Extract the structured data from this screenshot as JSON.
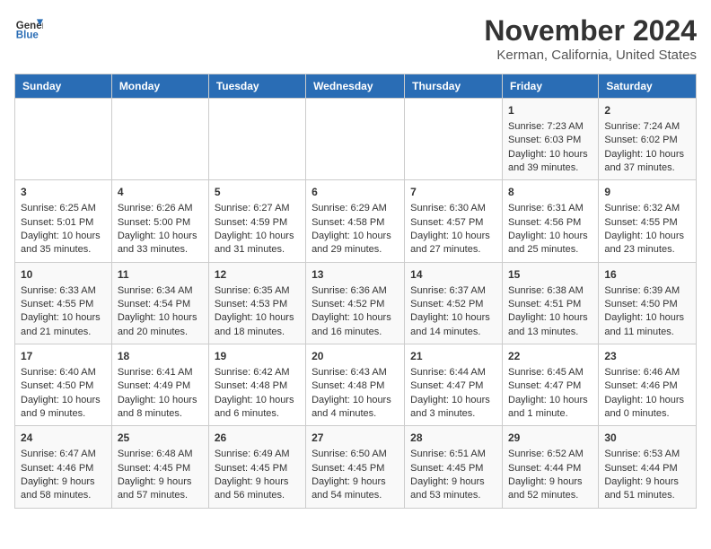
{
  "logo": {
    "line1": "General",
    "line2": "Blue"
  },
  "title": "November 2024",
  "subtitle": "Kerman, California, United States",
  "days_of_week": [
    "Sunday",
    "Monday",
    "Tuesday",
    "Wednesday",
    "Thursday",
    "Friday",
    "Saturday"
  ],
  "weeks": [
    [
      {
        "day": "",
        "content": ""
      },
      {
        "day": "",
        "content": ""
      },
      {
        "day": "",
        "content": ""
      },
      {
        "day": "",
        "content": ""
      },
      {
        "day": "",
        "content": ""
      },
      {
        "day": "1",
        "content": "Sunrise: 7:23 AM\nSunset: 6:03 PM\nDaylight: 10 hours and 39 minutes."
      },
      {
        "day": "2",
        "content": "Sunrise: 7:24 AM\nSunset: 6:02 PM\nDaylight: 10 hours and 37 minutes."
      }
    ],
    [
      {
        "day": "3",
        "content": "Sunrise: 6:25 AM\nSunset: 5:01 PM\nDaylight: 10 hours and 35 minutes."
      },
      {
        "day": "4",
        "content": "Sunrise: 6:26 AM\nSunset: 5:00 PM\nDaylight: 10 hours and 33 minutes."
      },
      {
        "day": "5",
        "content": "Sunrise: 6:27 AM\nSunset: 4:59 PM\nDaylight: 10 hours and 31 minutes."
      },
      {
        "day": "6",
        "content": "Sunrise: 6:29 AM\nSunset: 4:58 PM\nDaylight: 10 hours and 29 minutes."
      },
      {
        "day": "7",
        "content": "Sunrise: 6:30 AM\nSunset: 4:57 PM\nDaylight: 10 hours and 27 minutes."
      },
      {
        "day": "8",
        "content": "Sunrise: 6:31 AM\nSunset: 4:56 PM\nDaylight: 10 hours and 25 minutes."
      },
      {
        "day": "9",
        "content": "Sunrise: 6:32 AM\nSunset: 4:55 PM\nDaylight: 10 hours and 23 minutes."
      }
    ],
    [
      {
        "day": "10",
        "content": "Sunrise: 6:33 AM\nSunset: 4:55 PM\nDaylight: 10 hours and 21 minutes."
      },
      {
        "day": "11",
        "content": "Sunrise: 6:34 AM\nSunset: 4:54 PM\nDaylight: 10 hours and 20 minutes."
      },
      {
        "day": "12",
        "content": "Sunrise: 6:35 AM\nSunset: 4:53 PM\nDaylight: 10 hours and 18 minutes."
      },
      {
        "day": "13",
        "content": "Sunrise: 6:36 AM\nSunset: 4:52 PM\nDaylight: 10 hours and 16 minutes."
      },
      {
        "day": "14",
        "content": "Sunrise: 6:37 AM\nSunset: 4:52 PM\nDaylight: 10 hours and 14 minutes."
      },
      {
        "day": "15",
        "content": "Sunrise: 6:38 AM\nSunset: 4:51 PM\nDaylight: 10 hours and 13 minutes."
      },
      {
        "day": "16",
        "content": "Sunrise: 6:39 AM\nSunset: 4:50 PM\nDaylight: 10 hours and 11 minutes."
      }
    ],
    [
      {
        "day": "17",
        "content": "Sunrise: 6:40 AM\nSunset: 4:50 PM\nDaylight: 10 hours and 9 minutes."
      },
      {
        "day": "18",
        "content": "Sunrise: 6:41 AM\nSunset: 4:49 PM\nDaylight: 10 hours and 8 minutes."
      },
      {
        "day": "19",
        "content": "Sunrise: 6:42 AM\nSunset: 4:48 PM\nDaylight: 10 hours and 6 minutes."
      },
      {
        "day": "20",
        "content": "Sunrise: 6:43 AM\nSunset: 4:48 PM\nDaylight: 10 hours and 4 minutes."
      },
      {
        "day": "21",
        "content": "Sunrise: 6:44 AM\nSunset: 4:47 PM\nDaylight: 10 hours and 3 minutes."
      },
      {
        "day": "22",
        "content": "Sunrise: 6:45 AM\nSunset: 4:47 PM\nDaylight: 10 hours and 1 minute."
      },
      {
        "day": "23",
        "content": "Sunrise: 6:46 AM\nSunset: 4:46 PM\nDaylight: 10 hours and 0 minutes."
      }
    ],
    [
      {
        "day": "24",
        "content": "Sunrise: 6:47 AM\nSunset: 4:46 PM\nDaylight: 9 hours and 58 minutes."
      },
      {
        "day": "25",
        "content": "Sunrise: 6:48 AM\nSunset: 4:45 PM\nDaylight: 9 hours and 57 minutes."
      },
      {
        "day": "26",
        "content": "Sunrise: 6:49 AM\nSunset: 4:45 PM\nDaylight: 9 hours and 56 minutes."
      },
      {
        "day": "27",
        "content": "Sunrise: 6:50 AM\nSunset: 4:45 PM\nDaylight: 9 hours and 54 minutes."
      },
      {
        "day": "28",
        "content": "Sunrise: 6:51 AM\nSunset: 4:45 PM\nDaylight: 9 hours and 53 minutes."
      },
      {
        "day": "29",
        "content": "Sunrise: 6:52 AM\nSunset: 4:44 PM\nDaylight: 9 hours and 52 minutes."
      },
      {
        "day": "30",
        "content": "Sunrise: 6:53 AM\nSunset: 4:44 PM\nDaylight: 9 hours and 51 minutes."
      }
    ]
  ]
}
